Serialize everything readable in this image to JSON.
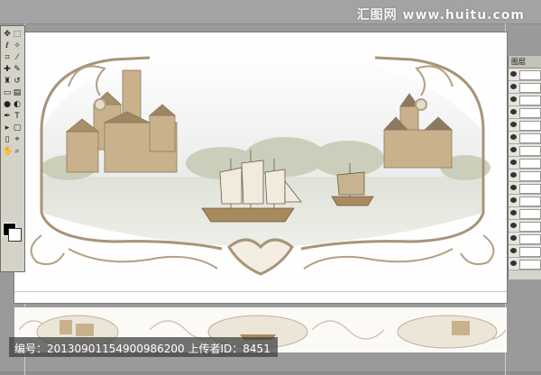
{
  "watermark": "汇图网 www.huitu.com",
  "layers_panel": {
    "tab_label": "图层"
  },
  "caption": "编号：20130901154900986200 上传者ID：8451",
  "colors": {
    "canvas": "#fefefe",
    "frame_stroke": "#a89478",
    "sepia": "#b9a27d",
    "sky": "#eef1f2",
    "water": "#d9dcd3"
  },
  "icons": [
    "move-icon",
    "marquee-icon",
    "lasso-icon",
    "magic-wand-icon",
    "crop-icon",
    "slice-icon",
    "healing-brush-icon",
    "brush-icon",
    "clone-stamp-icon",
    "history-brush-icon",
    "eraser-icon",
    "gradient-icon",
    "blur-icon",
    "dodge-icon",
    "pen-icon",
    "type-icon",
    "path-select-icon",
    "shape-icon",
    "notes-icon",
    "eyedropper-icon",
    "hand-icon",
    "zoom-icon"
  ]
}
